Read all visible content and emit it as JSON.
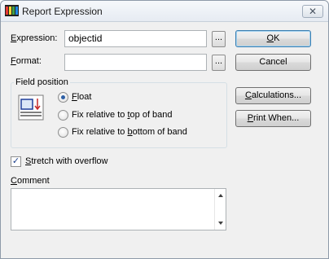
{
  "window": {
    "title": "Report Expression",
    "close_glyph": "✕",
    "title_icon": "app-icon"
  },
  "expression": {
    "label_underlined": "E",
    "label_rest": "xpression:",
    "value": "objectid",
    "browse_label": "..."
  },
  "format": {
    "label_underlined": "F",
    "label_rest": "ormat:",
    "value": "",
    "browse_label": "..."
  },
  "buttons": {
    "ok": {
      "underlined": "O",
      "rest": "K"
    },
    "cancel": "Cancel",
    "calculations": {
      "underlined": "C",
      "rest": "alculations..."
    },
    "print_when": {
      "underlined": "P",
      "rest": "rint When..."
    }
  },
  "field_position": {
    "title": "Field position",
    "icon": "field-position-icon",
    "options": [
      {
        "pre": "",
        "underlined": "F",
        "post": "loat",
        "checked": true
      },
      {
        "pre": "Fix relative to ",
        "underlined": "t",
        "post": "op of band",
        "checked": false
      },
      {
        "pre": "Fix relative to ",
        "underlined": "b",
        "post": "ottom of band",
        "checked": false
      }
    ]
  },
  "stretch": {
    "checked": true,
    "check_glyph": "✓",
    "label_underlined": "S",
    "label_rest": "tretch with overflow"
  },
  "comment": {
    "label_underlined": "C",
    "label_rest": "omment",
    "value": ""
  },
  "colors": {
    "default_button_border": "#3c7fb1",
    "radio_dot": "#2d5fa5"
  }
}
